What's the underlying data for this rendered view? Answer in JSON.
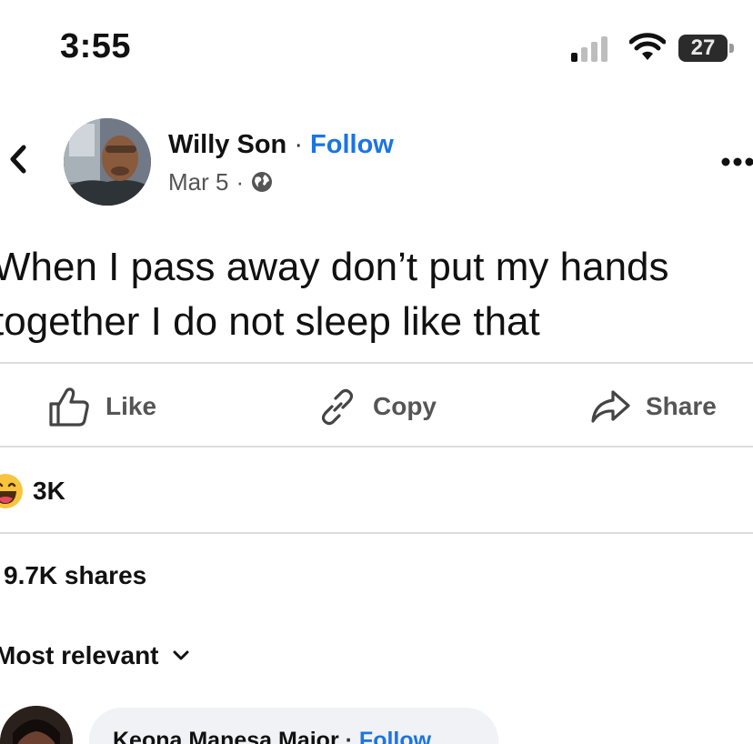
{
  "status_bar": {
    "time": "3:55",
    "battery": "27",
    "icons": [
      "signal-icon",
      "wifi-icon",
      "battery-icon"
    ]
  },
  "post": {
    "author": "Willy Son",
    "separator": "·",
    "follow_label": "Follow",
    "date": "Mar 5",
    "date_separator": "·",
    "visibility_icon": "globe-icon",
    "text_lines": [
      "When I pass away don’t put my hands",
      "together I do not sleep like that"
    ]
  },
  "actions": {
    "like": "Like",
    "copy": "Copy",
    "share": "Share"
  },
  "reactions": {
    "icon": "haha-emoji-icon",
    "count": "3K"
  },
  "shares_text": "9.7K shares",
  "sort_label": "Most relevant",
  "comment": {
    "author": "Keona Manesa Major",
    "separator": "·",
    "follow_label": "Follow"
  },
  "colors": {
    "accent": "#1b74e4",
    "muted": "#555555",
    "divider": "#dcdcdc",
    "bubble": "#f0f2f5"
  }
}
